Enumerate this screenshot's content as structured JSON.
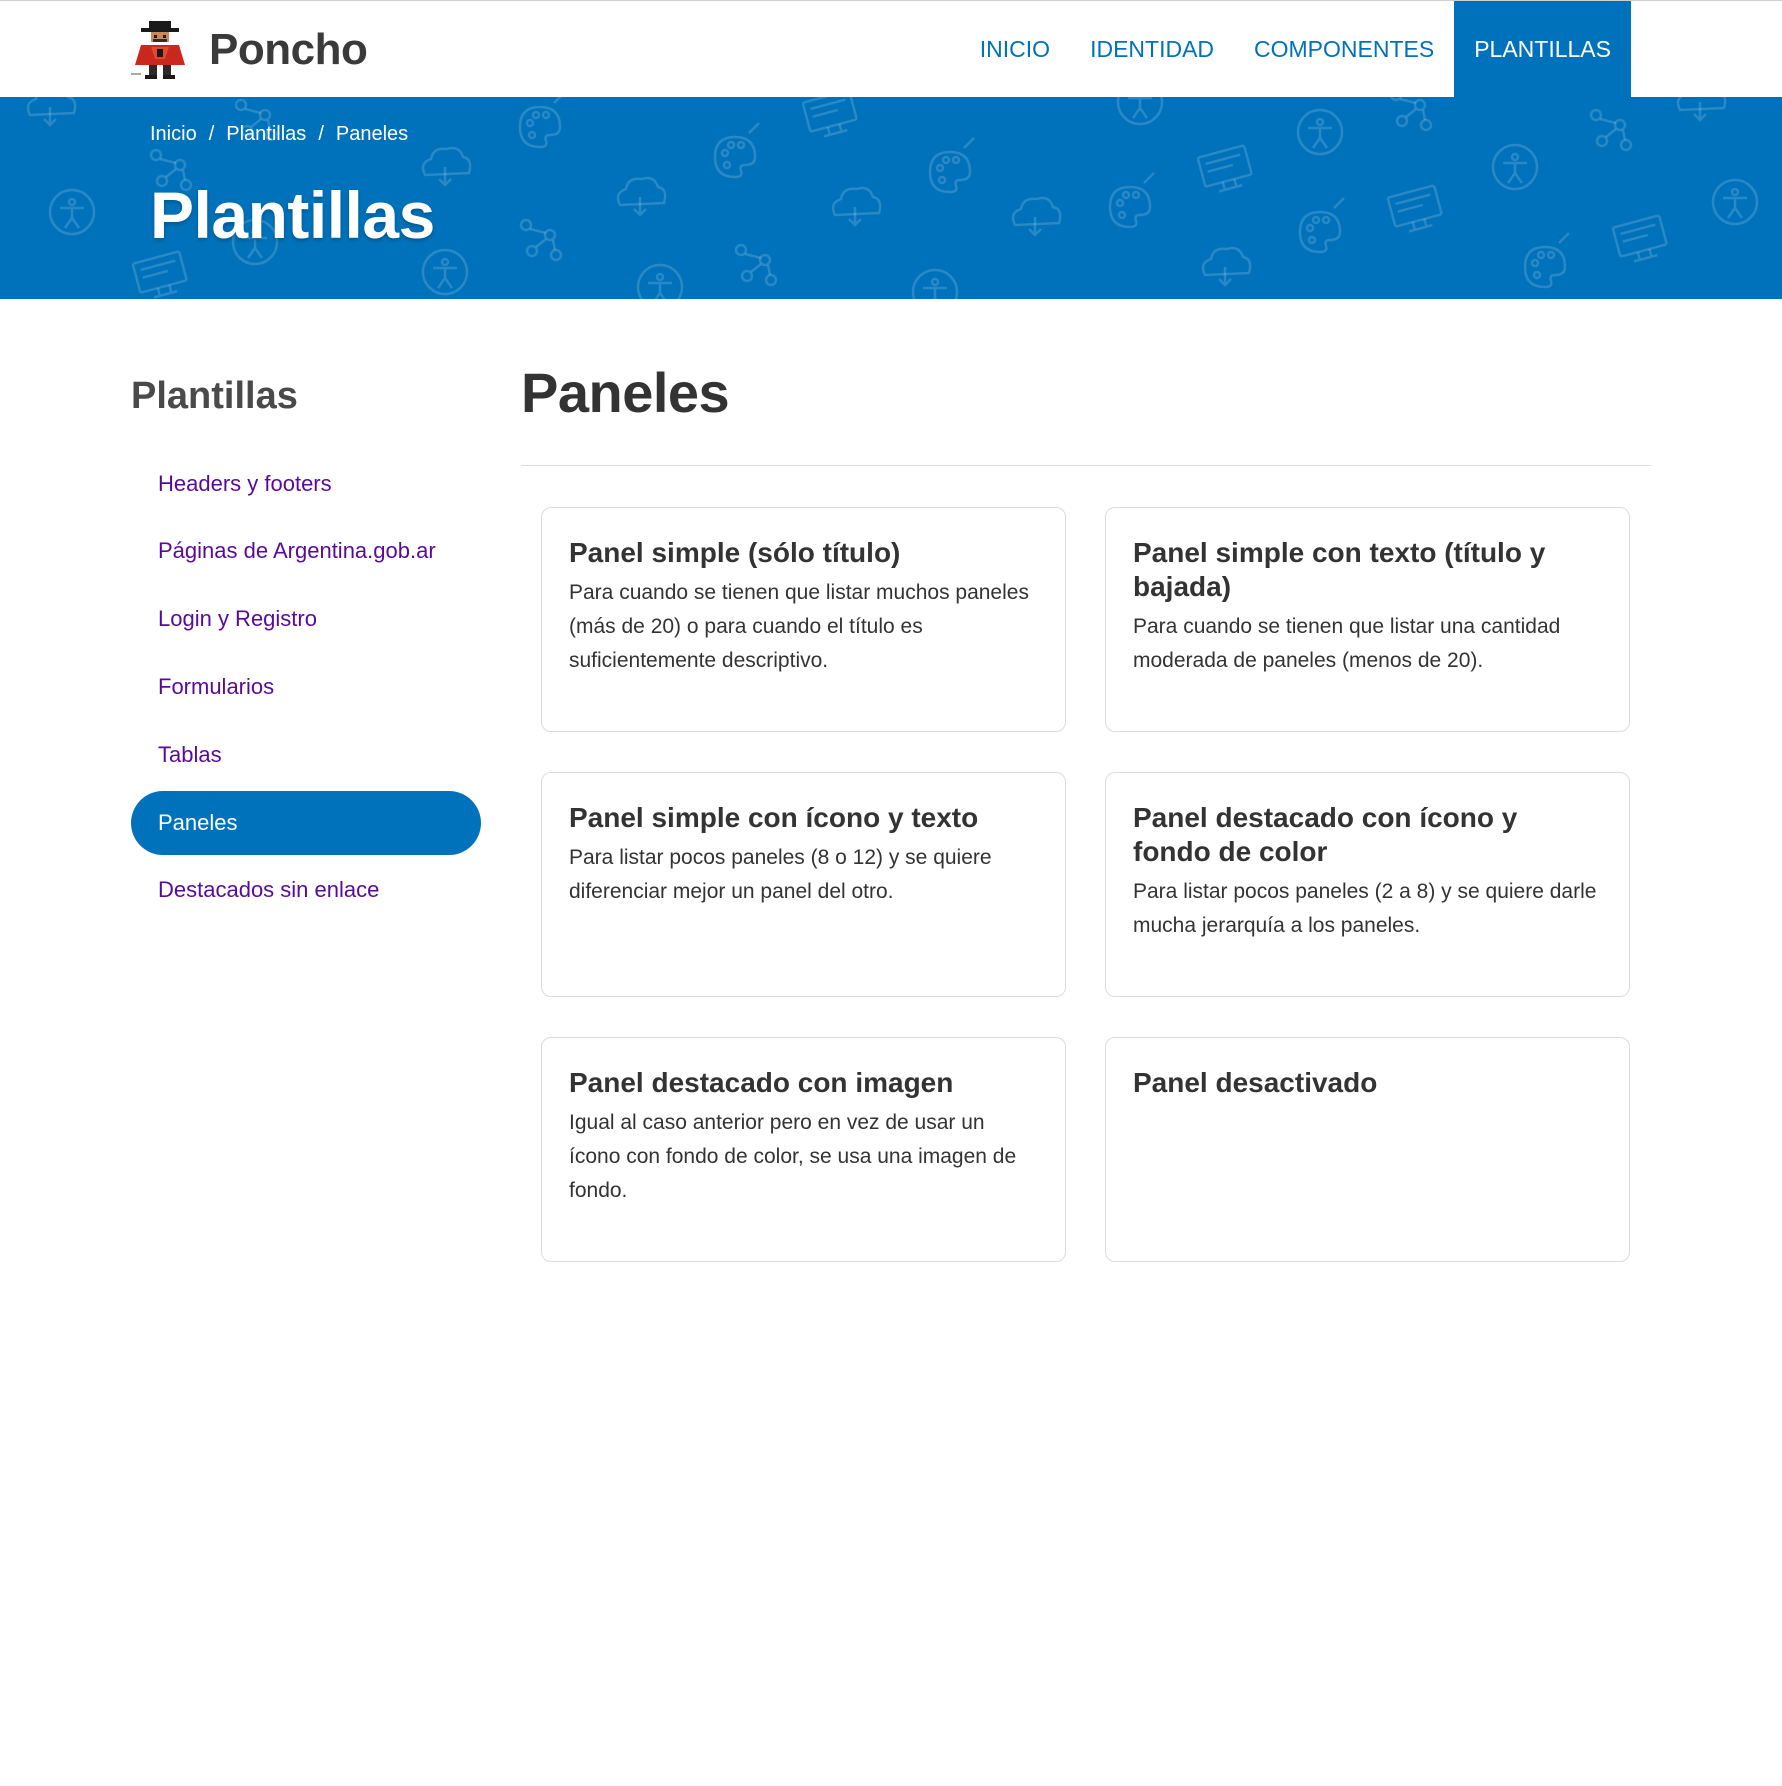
{
  "brand": {
    "name": "Poncho"
  },
  "nav": {
    "items": [
      {
        "label": "INICIO"
      },
      {
        "label": "IDENTIDAD"
      },
      {
        "label": "COMPONENTES"
      },
      {
        "label": "PLANTILLAS"
      }
    ],
    "active_index": 3
  },
  "breadcrumb": {
    "items": [
      "Inicio",
      "Plantillas",
      "Paneles"
    ],
    "separator": "/"
  },
  "hero": {
    "title": "Plantillas"
  },
  "sidebar": {
    "title": "Plantillas",
    "items": [
      {
        "label": "Headers y footers"
      },
      {
        "label": "Páginas de Argentina.gob.ar"
      },
      {
        "label": "Login y Registro"
      },
      {
        "label": "Formularios"
      },
      {
        "label": "Tablas"
      },
      {
        "label": "Paneles"
      },
      {
        "label": "Destacados sin enlace"
      }
    ],
    "active_index": 5
  },
  "main": {
    "title": "Paneles",
    "panels": [
      {
        "title": "Panel simple (sólo título)",
        "text": "Para cuando se tienen que listar muchos paneles (más de 20) o para cuando el título es suficientemente descriptivo."
      },
      {
        "title": "Panel simple con texto (título y bajada)",
        "text": "Para cuando se tienen que listar una cantidad moderada de paneles (menos de 20)."
      },
      {
        "title": "Panel simple con ícono y texto",
        "text": "Para listar pocos paneles (8 o 12) y se quiere diferenciar mejor un panel del otro."
      },
      {
        "title": "Panel destacado con ícono y fondo de color",
        "text": "Para listar pocos paneles (2 a 8) y se quiere darle mucha jerarquía a los paneles."
      },
      {
        "title": "Panel destacado con imagen",
        "text": "Igual al caso anterior pero en vez de usar un ícono con fondo de color, se usa una imagen de fondo."
      },
      {
        "title": "Panel desactivado",
        "text": ""
      }
    ]
  },
  "colors": {
    "primary": "#0072bb",
    "sidebar_link": "#5a0a9a",
    "text": "#333333",
    "panel_border": "#dcdcdc"
  },
  "icons": {
    "hero_pattern": [
      "accessibility-icon",
      "cloud-icon",
      "palette-icon",
      "monitor-icon",
      "network-icon"
    ],
    "brand_logo": "gaucho-mascot-icon"
  }
}
